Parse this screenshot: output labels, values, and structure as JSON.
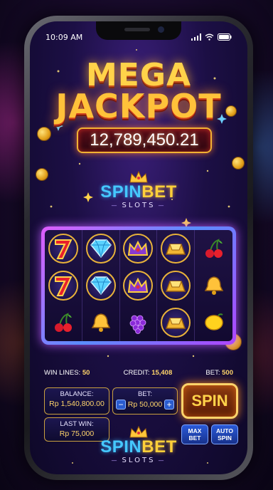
{
  "status_bar": {
    "time": "10:09 AM"
  },
  "jackpot": {
    "line1": "MEGA",
    "line2": "JACKPOT",
    "amount": "12,789,450.21"
  },
  "brand": {
    "name_part1": "SPIN",
    "name_part2": "BET",
    "subtitle": "SLOTS"
  },
  "reels": {
    "columns": [
      [
        "seven",
        "seven",
        "cherry"
      ],
      [
        "diamond",
        "diamond",
        "bell"
      ],
      [
        "crown",
        "crown",
        "grapes"
      ],
      [
        "gold-bar",
        "gold-bar",
        "gold-bar"
      ],
      [
        "cherry",
        "bell",
        "lemon"
      ]
    ]
  },
  "info_bar": {
    "win_lines_label": "WIN LINES:",
    "win_lines_value": "50",
    "credit_label": "CREDIT:",
    "credit_value": "15,408",
    "bet_label": "BET:",
    "bet_value": "500"
  },
  "panels": {
    "balance_label": "BALANCE:",
    "balance_value": "Rp 1,540,800.00",
    "bet_label": "BET:",
    "bet_value": "Rp 50,000",
    "bet_minus": "−",
    "bet_plus": "+",
    "last_win_label": "LAST WIN:",
    "last_win_value": "Rp 75,000"
  },
  "buttons": {
    "spin": "SPIN",
    "max_bet_line1": "MAX",
    "max_bet_line2": "BET",
    "auto_spin_line1": "AUTO",
    "auto_spin_line2": "SPIN"
  },
  "colors": {
    "accent_gold": "#ffd34a",
    "accent_blue": "#45c8ff",
    "frame_purple": "#b045ff"
  }
}
